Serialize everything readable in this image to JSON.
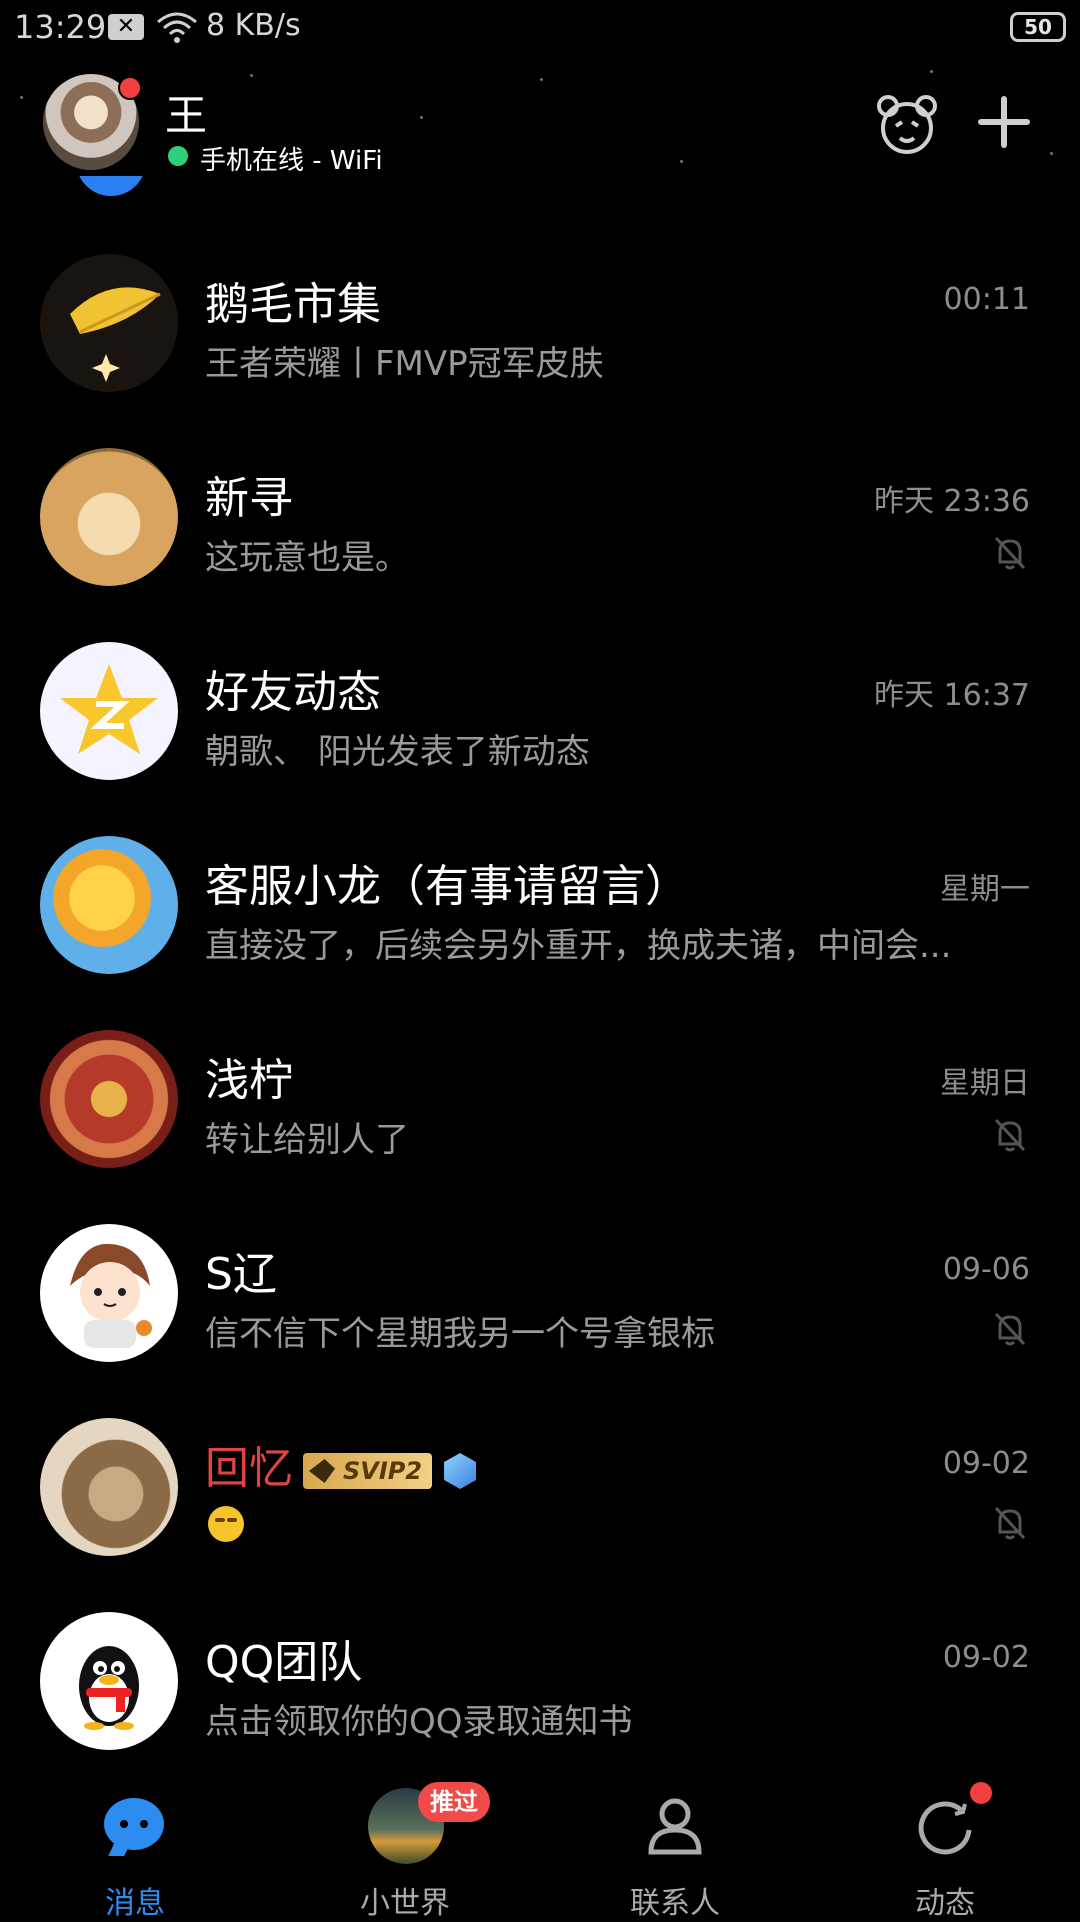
{
  "status_bar": {
    "time": "13:29",
    "notif_icon": "close-box-icon",
    "speed": "8 KB/s",
    "battery": "50"
  },
  "header": {
    "name": "王",
    "status": "手机在线 - WiFi",
    "icons": [
      "bear-face-icon",
      "plus-icon"
    ]
  },
  "chats": [
    {
      "name": "鹅毛市集",
      "message": "王者荣耀丨FMVP冠军皮肤",
      "time": "00:11",
      "muted": false,
      "avatar": "golden-feather-avatar"
    },
    {
      "name": "新寻",
      "message": "这玩意也是。",
      "time": "昨天 23:36",
      "muted": true,
      "avatar": "shiba-dog-avatar"
    },
    {
      "name": "好友动态",
      "message": "朝歌、 阳光发表了新动态",
      "time": "昨天 16:37",
      "muted": false,
      "avatar": "qzone-star-avatar"
    },
    {
      "name": "客服小龙（有事请留言）",
      "message": "直接没了，后续会另外重开，换成夫诸，中间会...",
      "time": "星期一",
      "muted": false,
      "avatar": "cartoon-dragon-avatar"
    },
    {
      "name": "浅柠",
      "message": "转让给别人了",
      "time": "星期日",
      "muted": true,
      "avatar": "red-dragon-art-avatar"
    },
    {
      "name": "S辽",
      "message": "信不信下个星期我另一个号拿银标",
      "time": "09-06",
      "muted": true,
      "avatar": "anime-boy-avatar"
    },
    {
      "name": "回忆",
      "message": "",
      "time": "09-02",
      "muted": true,
      "avatar": "cat-avatar",
      "badge": "SVIP2",
      "emoji": "grinning-face-emoji"
    },
    {
      "name": "QQ团队",
      "message": "点击领取你的QQ录取通知书",
      "time": "09-02",
      "muted": false,
      "avatar": "qq-penguin-avatar"
    }
  ],
  "bottom_nav": [
    {
      "label": "消息",
      "active": true,
      "icon": "message-bubble-icon"
    },
    {
      "label": "小世界",
      "active": false,
      "icon": "world-avatar-icon",
      "badge": "推过"
    },
    {
      "label": "联系人",
      "active": false,
      "icon": "contacts-icon"
    },
    {
      "label": "动态",
      "active": false,
      "icon": "moments-icon",
      "dot": true
    }
  ],
  "colors": {
    "background": "#000000",
    "accent": "#2d8cf0",
    "badge_red": "#f04a4a",
    "online_green": "#2fd07a",
    "muted_text": "#9a9a9a"
  }
}
